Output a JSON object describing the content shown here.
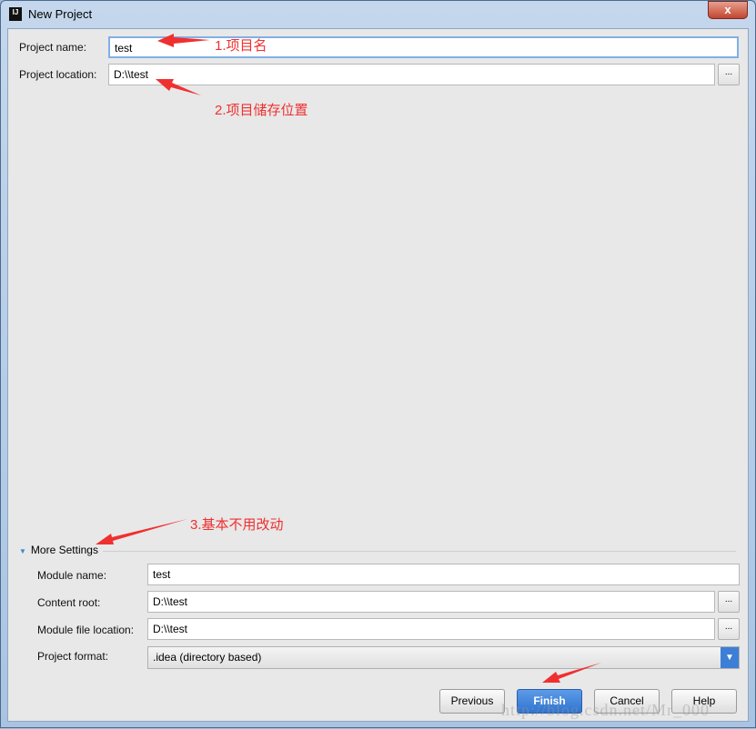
{
  "window": {
    "title": "New Project",
    "app_icon": "IJ",
    "close_label": "x"
  },
  "fields": {
    "project_name": {
      "label": "Project name:",
      "value": "test"
    },
    "project_location": {
      "label": "Project location:",
      "value": "D:\\\\test"
    },
    "browse_label": "..."
  },
  "more_settings": {
    "title": "More Settings",
    "module_name": {
      "label": "Module name:",
      "value": "test"
    },
    "content_root": {
      "label": "Content root:",
      "value": "D:\\\\test"
    },
    "module_file_location": {
      "label": "Module file location:",
      "value": "D:\\\\test"
    },
    "project_format": {
      "label": "Project format:",
      "value": ".idea (directory based)"
    }
  },
  "buttons": {
    "previous": "Previous",
    "finish": "Finish",
    "cancel": "Cancel",
    "help": "Help"
  },
  "annotations": [
    "1.项目名",
    "2.项目储存位置",
    "3.基本不用改动"
  ],
  "watermark": "http://blog.csdn.net/Mr_000",
  "colors": {
    "annotation": "#f03030",
    "primary": "#3d7fd6"
  }
}
